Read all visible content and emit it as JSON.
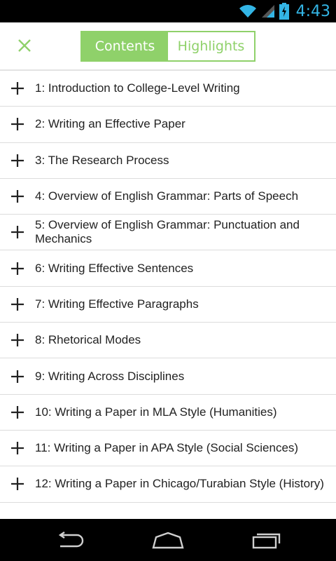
{
  "status_bar": {
    "time": "4:43",
    "icons": [
      "wifi-icon",
      "signal-icon",
      "battery-charging-icon"
    ]
  },
  "header": {
    "close_icon": "close-icon",
    "tabs": [
      {
        "label": "Contents",
        "active": true
      },
      {
        "label": "Highlights",
        "active": false
      }
    ]
  },
  "contents": {
    "items": [
      {
        "label": "1: Introduction to College-Level Writing"
      },
      {
        "label": "2: Writing an Effective Paper"
      },
      {
        "label": "3: The Research Process"
      },
      {
        "label": "4: Overview of English Grammar: Parts of Speech"
      },
      {
        "label": "5: Overview of English Grammar: Punctuation and Mechanics"
      },
      {
        "label": "6: Writing Effective Sentences"
      },
      {
        "label": "7: Writing Effective Paragraphs"
      },
      {
        "label": "8: Rhetorical Modes"
      },
      {
        "label": "9: Writing Across Disciplines"
      },
      {
        "label": "10: Writing a Paper in MLA Style (Humanities)"
      },
      {
        "label": "11: Writing a Paper in APA Style (Social Sciences)"
      },
      {
        "label": "12: Writing a Paper in Chicago/Turabian Style (History)"
      }
    ]
  },
  "nav_bar": {
    "buttons": [
      "back-icon",
      "home-icon",
      "recent-apps-icon"
    ]
  },
  "colors": {
    "accent": "#8fd16a",
    "status_time": "#33b5e5",
    "text": "#222222"
  }
}
